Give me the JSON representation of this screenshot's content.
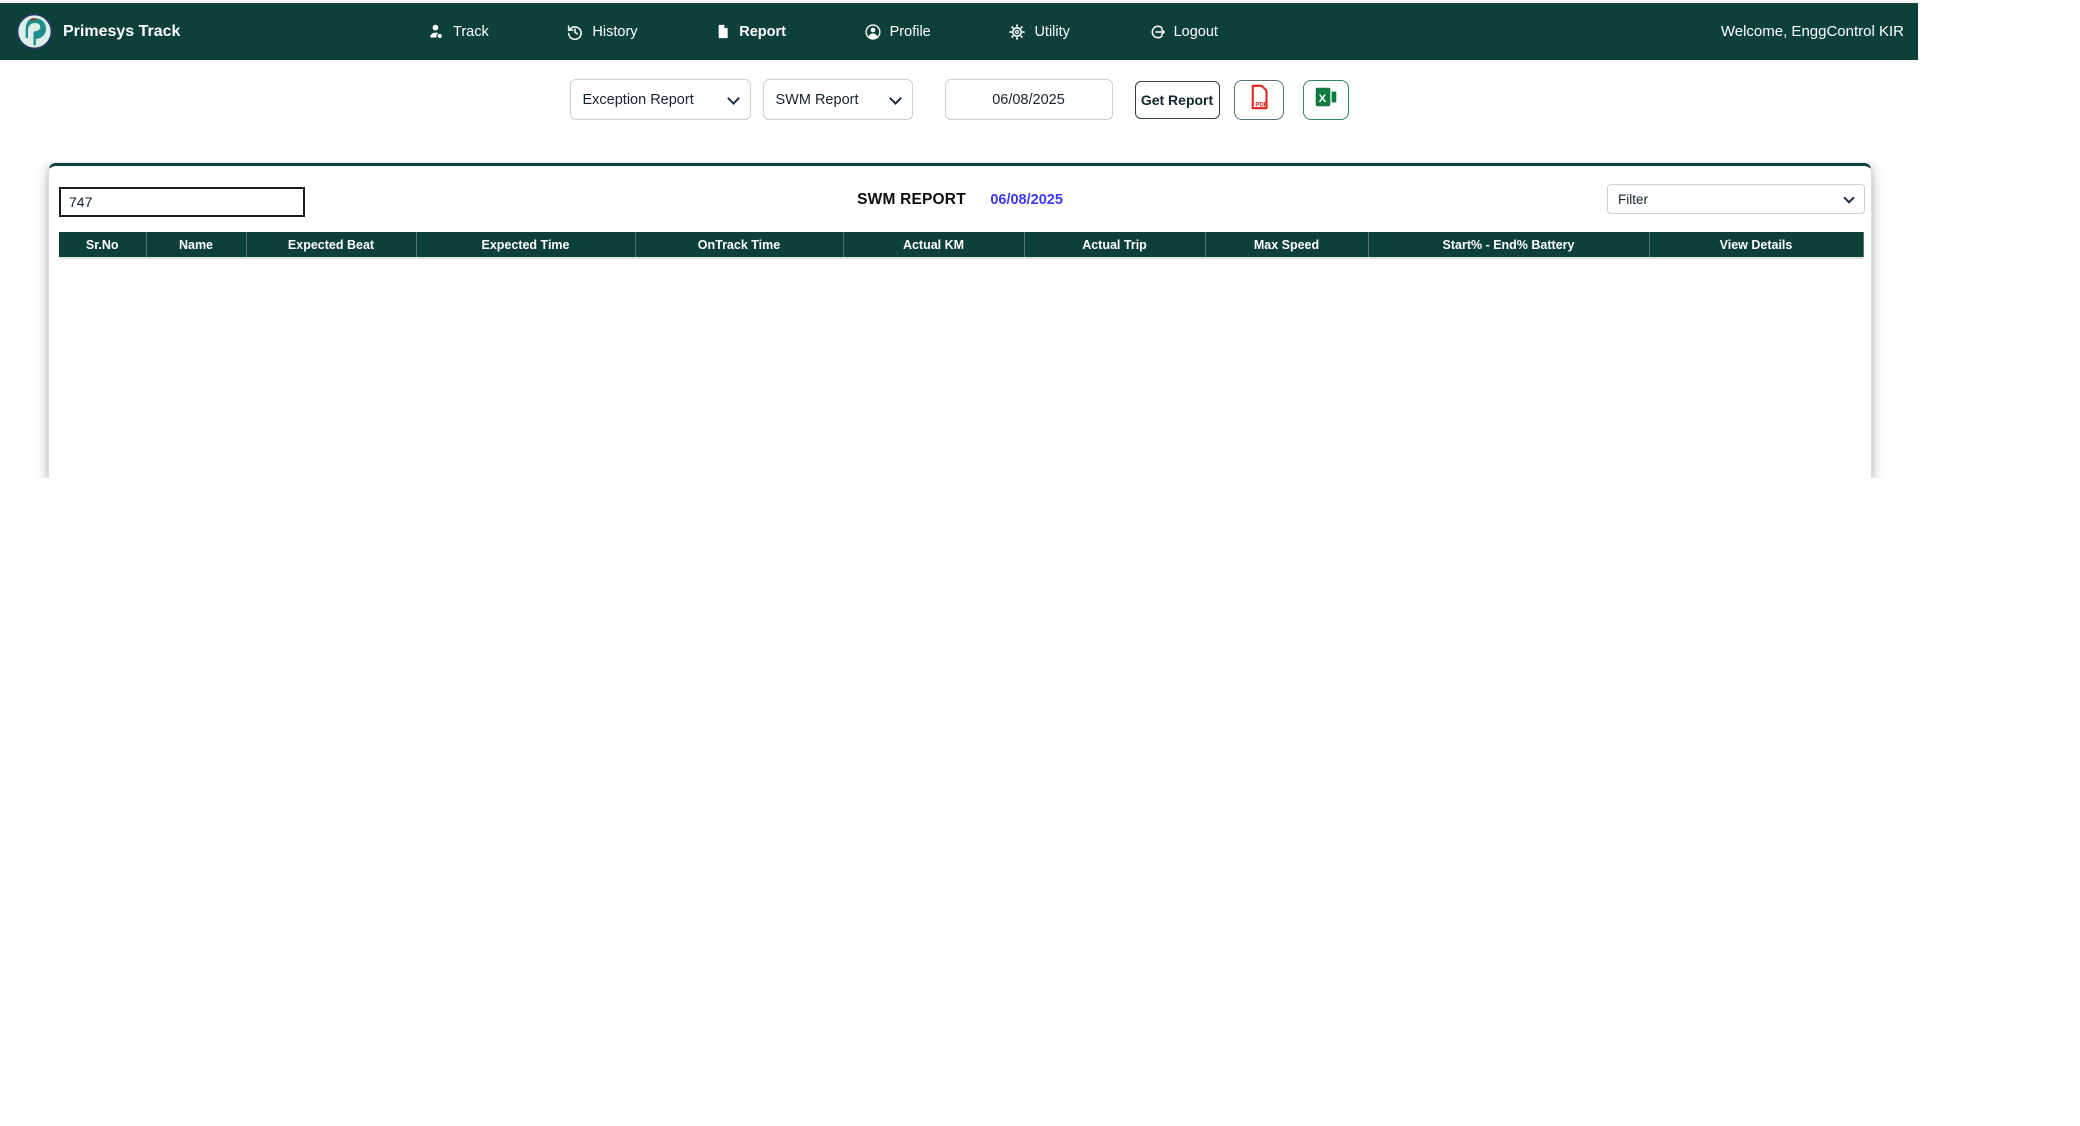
{
  "brand": {
    "name": "Primesys Track",
    "logo_icon": "primesys-logo-icon"
  },
  "navbar": {
    "items": [
      {
        "label": "Track",
        "icon": "person-pin-icon",
        "active": false
      },
      {
        "label": "History",
        "icon": "history-clock-icon",
        "active": false
      },
      {
        "label": "Report",
        "icon": "document-icon",
        "active": true
      },
      {
        "label": "Profile",
        "icon": "profile-circle-icon",
        "active": false
      },
      {
        "label": "Utility",
        "icon": "gear-icon",
        "active": false
      },
      {
        "label": "Logout",
        "icon": "logout-icon",
        "active": false
      }
    ],
    "welcome_text": "Welcome, EnggControl KIR"
  },
  "toolbar": {
    "report_type_selected": "Exception Report",
    "report_name_selected": "SWM Report",
    "date_value": "06/08/2025",
    "get_report_label": "Get Report",
    "pdf_export_icon": "pdf-export-icon",
    "excel_export_icon": "excel-export-icon"
  },
  "panel": {
    "search_value": "747",
    "title": "SWM REPORT",
    "title_date": "06/08/2025",
    "filter_selected": "Filter",
    "table": {
      "columns": [
        "Sr.No",
        "Name",
        "Expected Beat",
        "Expected Time",
        "OnTrack Time",
        "Actual KM",
        "Actual Trip",
        "Max Speed",
        "Start% - End% Battery",
        "View Details"
      ],
      "rows": []
    }
  },
  "colors": {
    "navbar_bg": "#0d4039",
    "table_header_bg": "#0d4039",
    "title_date_blue": "#3a3af2",
    "pdf_red": "#e2231a",
    "excel_green": "#107c41"
  }
}
